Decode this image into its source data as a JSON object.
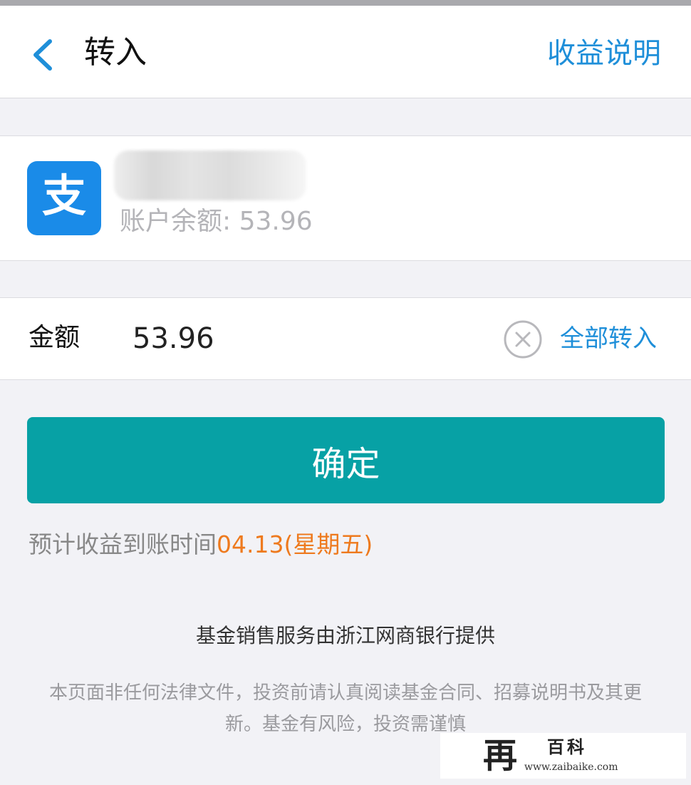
{
  "nav": {
    "title": "转入",
    "right_link": "收益说明"
  },
  "account": {
    "icon": "alipay-icon",
    "logo_glyph": "支",
    "balance_text": "账户余额: 53.96"
  },
  "amount": {
    "label": "金额",
    "value": "53.96",
    "transfer_all_label": "全部转入"
  },
  "confirm": {
    "label": "确定"
  },
  "arrival": {
    "prefix": "预计收益到账时间",
    "date": "04.13(星期五)"
  },
  "footer": {
    "provider": "基金销售服务由浙江网商银行提供",
    "disclaimer": "本页面非任何法律文件，投资前请认真阅读基金合同、招募说明书及其更新。基金有风险，投资需谨慎"
  },
  "watermark": {
    "glyph": "再",
    "title": "百科",
    "url": "www.zaibaike.com"
  },
  "colors": {
    "accent_blue": "#1f8fd9",
    "confirm_teal": "#07a1a5",
    "date_orange": "#ee7a1e",
    "alipay_blue": "#1a8be8"
  }
}
